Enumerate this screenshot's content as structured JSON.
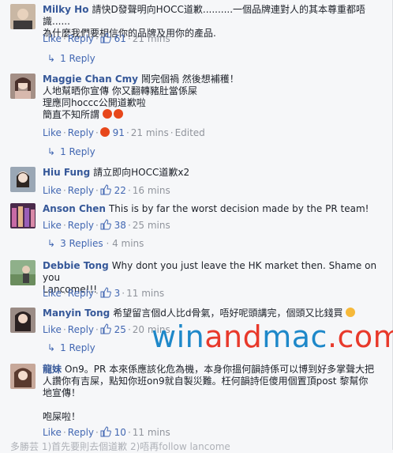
{
  "comments": [
    {
      "author": "Milky Ho",
      "text": "請快D發聲明向HOCC道歉..........一個品牌連對人的其本尊重都唔識......\n為什麼我們要相信你的品牌及用你的產品.",
      "like": "Like",
      "reply": "Reply",
      "likes": "61",
      "time": "21 mins",
      "replies": "1 Reply"
    },
    {
      "author": "Maggie Chan Cmy",
      "text": "鬧完個禍 然後想補穫！\n人地幫晒你宣傳 你又翻轉豬肚當係屎\n理應同hoccc公開道歉啦\n簡直不知所謂",
      "like": "Like",
      "reply": "Reply",
      "likes": "91",
      "time": "21 mins",
      "edited": "Edited",
      "replies": "1 Reply"
    },
    {
      "author": "Hiu Fung",
      "text": "請立即向HOCC道歉x2",
      "like": "Like",
      "reply": "Reply",
      "likes": "22",
      "time": "16 mins"
    },
    {
      "author": "Anson Chen",
      "text": "This is by far the worst decision made by the PR team!",
      "like": "Like",
      "reply": "Reply",
      "likes": "38",
      "time": "25 mins",
      "replies": "3 Replies",
      "replies_time": "4 mins"
    },
    {
      "author": "Debbie Tong",
      "text": "Why dont you just leave the HK market then. Shame on you\nLancome!!!",
      "like": "Like",
      "reply": "Reply",
      "likes": "3",
      "time": "11 mins"
    },
    {
      "author": "Manyin Tong",
      "text": "希望留言個d人比d骨氣，唔好呢頭講完，個頭又比錢買",
      "like": "Like",
      "reply": "Reply",
      "likes": "25",
      "time": "20 mins",
      "replies": "1 Reply"
    },
    {
      "author": "龍妹",
      "text": "On9。PR 本來係應該化危為機，本身你搵何韻詩係可以博到好多掌聲大把\n人讚你有吉屎，點知你班on9就自製災難。枉何韻詩佢傻用個置頂post 黎幫你\n地宣傳！\n\n咆屎啦！",
      "like": "Like",
      "reply": "Reply",
      "likes": "10",
      "time": "11 mins"
    }
  ],
  "watermark": {
    "part1": "win",
    "part2": "and",
    "part3": "mac",
    "part4": ".com"
  },
  "cutoff_text": "多勝芸  1)首先要則去個道歉  2)唔再follow lancome"
}
